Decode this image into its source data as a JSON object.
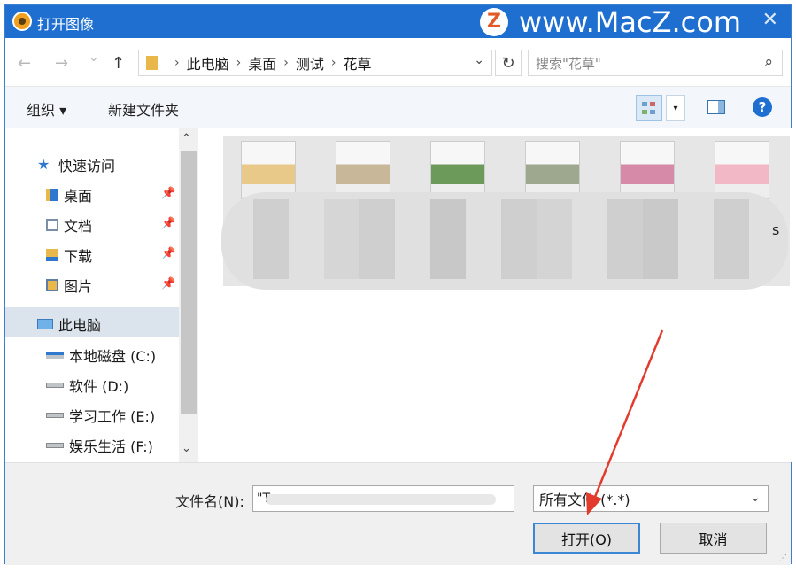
{
  "window": {
    "title": "打开图像",
    "close_glyph": "✕"
  },
  "watermark": {
    "badge": "Z",
    "text": "www.MacZ.com"
  },
  "nav": {
    "back_glyph": "←",
    "forward_glyph": "→",
    "recent_glyph": "⌄",
    "up_glyph": "↑",
    "crumbs": [
      "此电脑",
      "桌面",
      "测试",
      "花草"
    ],
    "crumb_sep": "›",
    "dropdown_glyph": "⌄",
    "refresh_glyph": "↻",
    "search_placeholder": "搜索\"花草\"",
    "search_glyph": "⌕"
  },
  "toolbar": {
    "organize": "组织 ▾",
    "new_folder": "新建文件夹",
    "help": "?"
  },
  "sidebar": {
    "quick_access": "快速访问",
    "pinned": [
      {
        "label": "桌面",
        "icon": "desktop-folder-icon"
      },
      {
        "label": "文档",
        "icon": "documents-folder-icon"
      },
      {
        "label": "下载",
        "icon": "downloads-folder-icon"
      },
      {
        "label": "图片",
        "icon": "pictures-folder-icon"
      }
    ],
    "this_pc": "此电脑",
    "drives": [
      "本地磁盘 (C:)",
      "软件 (D:)",
      "学习工作 (E:)",
      "娱乐生活 (F:)"
    ],
    "pin_glyph": "📌",
    "scroll_up": "⌃",
    "scroll_down": "⌄"
  },
  "files": {
    "thumbnails": [
      {
        "name": "child-reading-thumbnail",
        "color": "#e9c98a"
      },
      {
        "name": "table-chairs-thumbnail",
        "color": "#c9b79a"
      },
      {
        "name": "green-plant-thumbnail",
        "color": "#6c9a5a"
      },
      {
        "name": "white-flowers-thumbnail",
        "color": "#9ea88f"
      },
      {
        "name": "pink-tulips-thumbnail",
        "color": "#d78aa8"
      },
      {
        "name": "pink-flowers-thumbnail",
        "color": "#f2b8c6"
      }
    ],
    "stray_char": "s"
  },
  "bottom": {
    "filename_label": "文件名(N):",
    "filename_value": "\"T",
    "filetype_value": "所有文件 (*.*)",
    "open_button": "打开(O)",
    "cancel_button": "取消"
  },
  "colors": {
    "titlebar": "#1e6fd0",
    "annotation_arrow": "#e23b2e"
  }
}
